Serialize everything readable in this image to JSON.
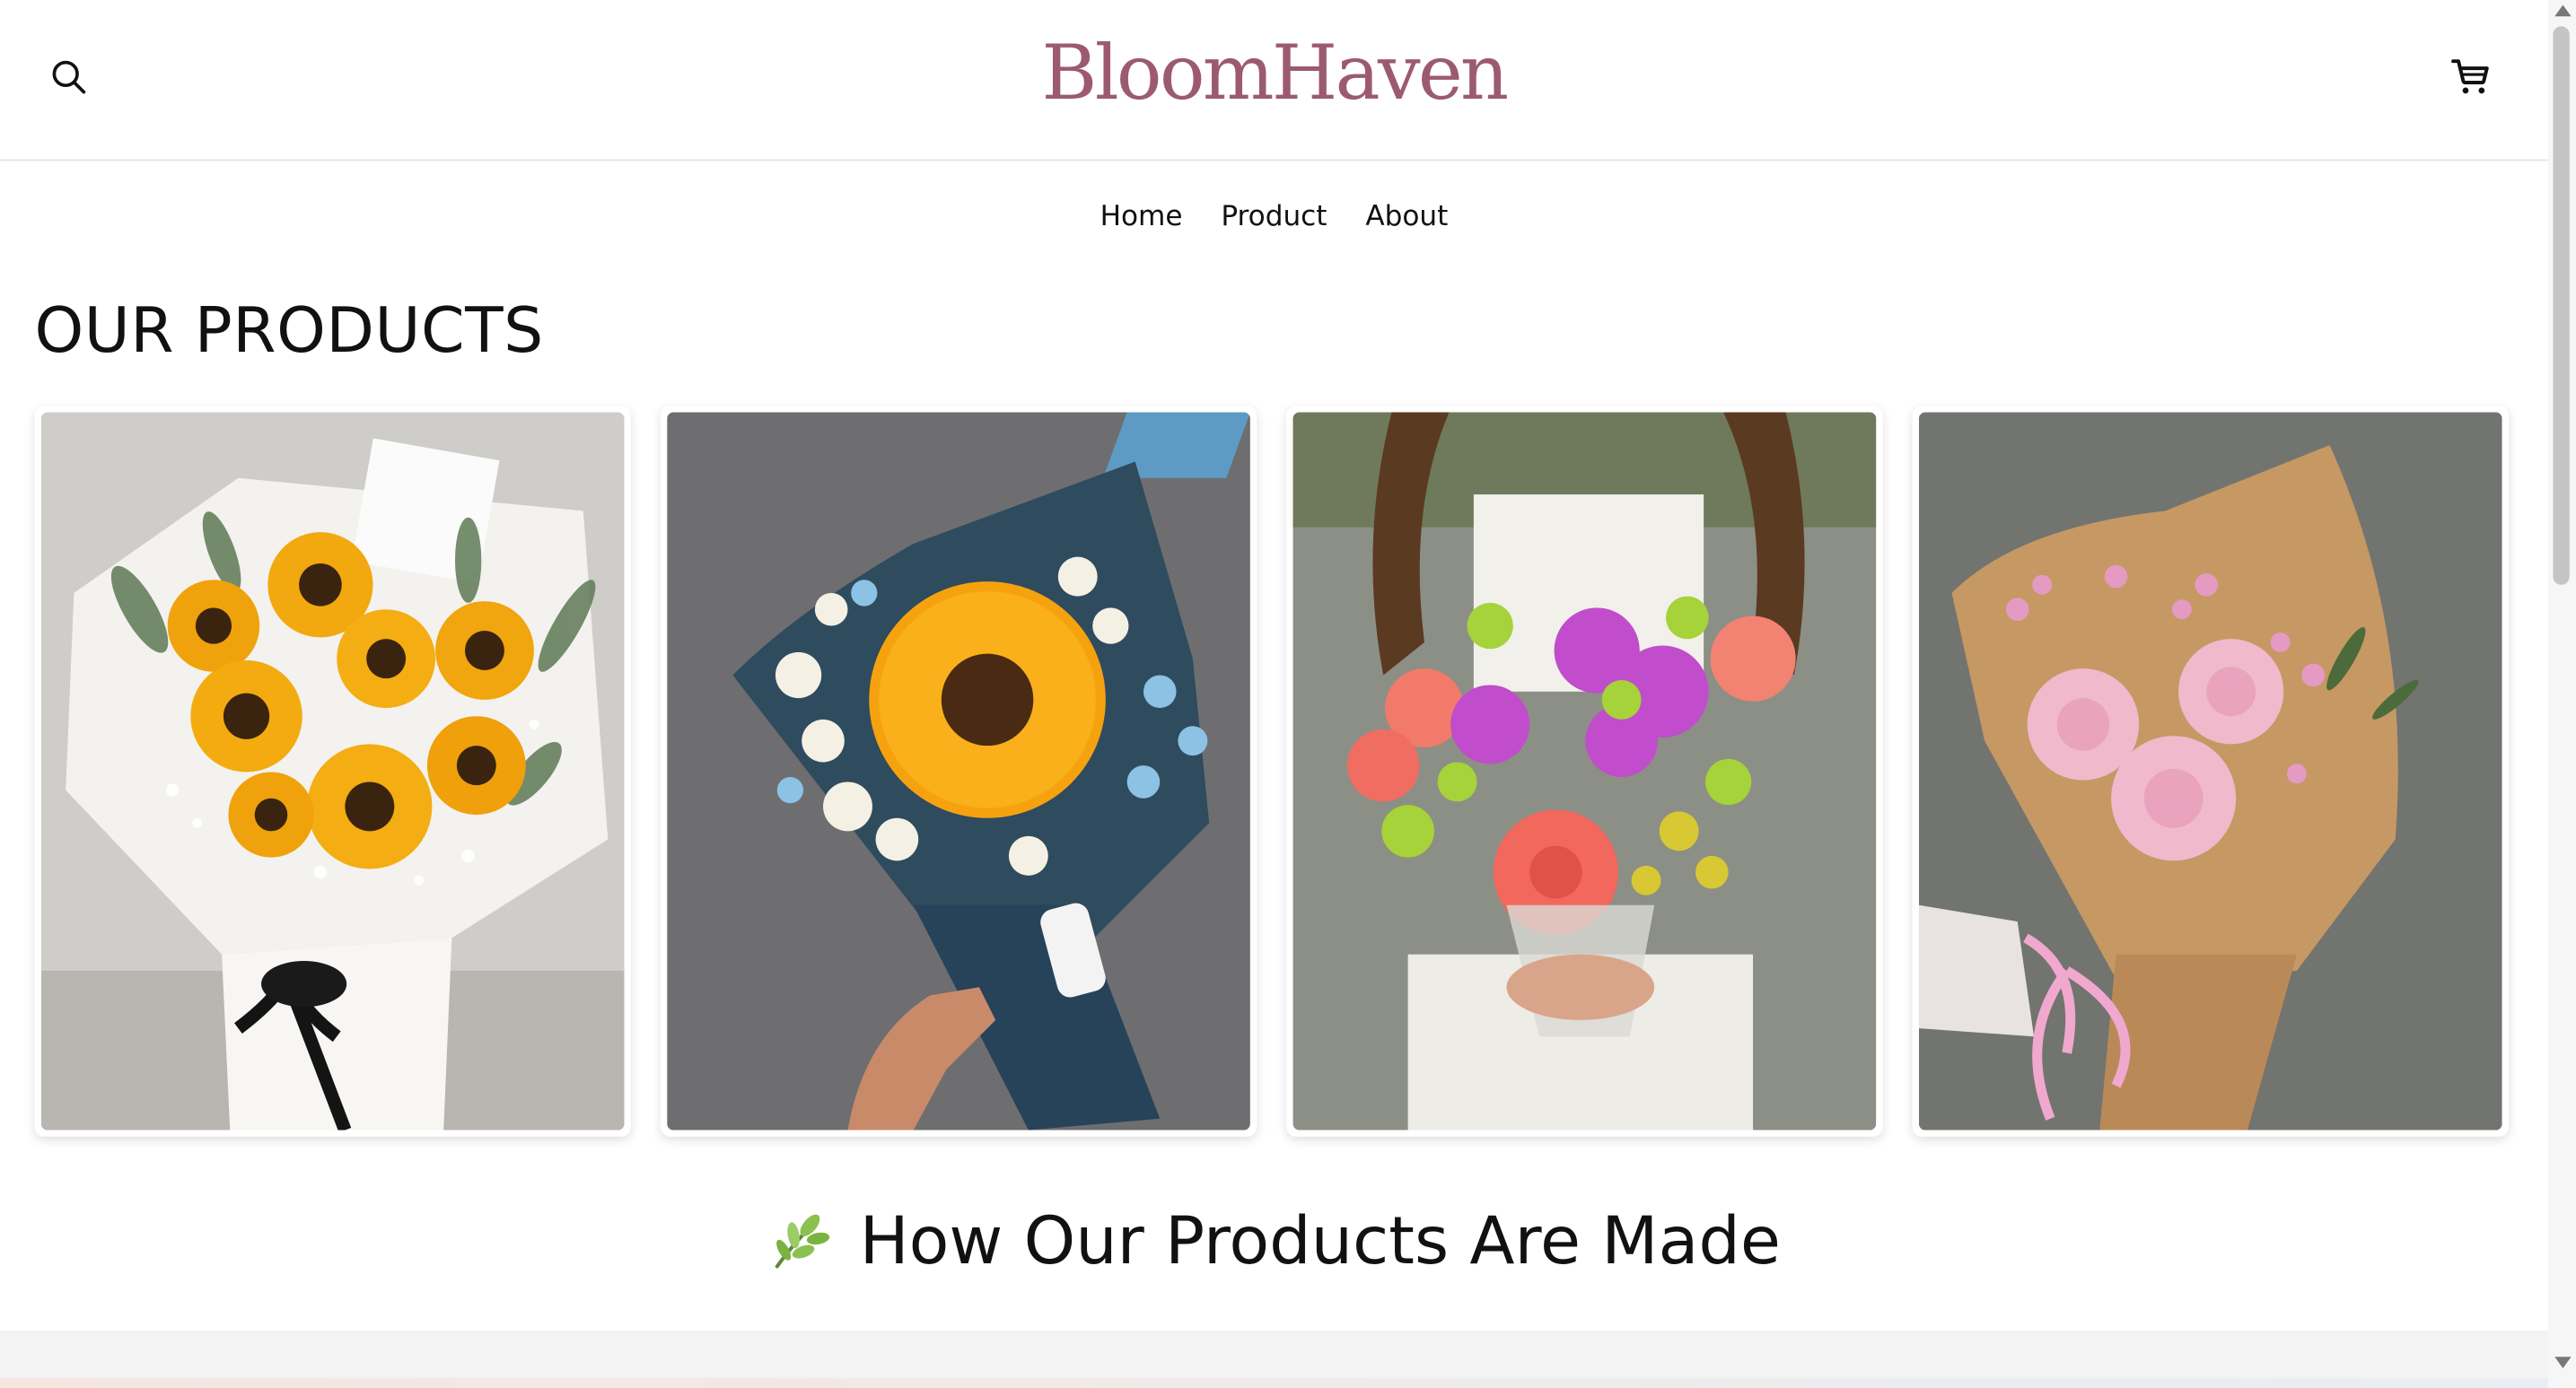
{
  "header": {
    "brand": "BloomHaven"
  },
  "nav": {
    "items": [
      {
        "label": "Home"
      },
      {
        "label": "Product"
      },
      {
        "label": "About"
      }
    ]
  },
  "products": {
    "title": "OUR PRODUCTS",
    "cards": [
      {
        "subject": "sunflower bouquet in white wrap with black ribbon"
      },
      {
        "subject": "single sunflower with baby's breath in navy wrap"
      },
      {
        "subject": "mixed bouquet with coral roses, purple daisies, green mums"
      },
      {
        "subject": "pink carnations in kraft paper with pink ribbon"
      }
    ]
  },
  "how_made": {
    "title": "How Our Products Are Made"
  },
  "colors": {
    "brand": "#9c5a72",
    "text": "#111111",
    "divider": "#e6e6e6",
    "band": "#f3f3f4"
  }
}
